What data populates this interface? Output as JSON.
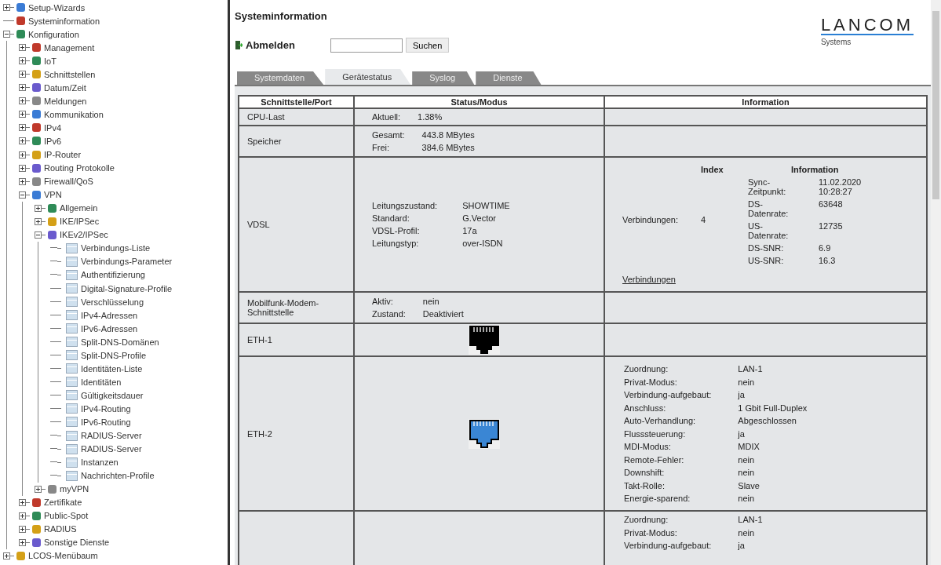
{
  "tree": [
    {
      "label": "Setup-Wizards",
      "expanded": false
    },
    {
      "label": "Systeminformation"
    },
    {
      "label": "Konfiguration",
      "expanded": true,
      "children": [
        {
          "label": "Management",
          "expanded": false
        },
        {
          "label": "IoT",
          "expanded": false
        },
        {
          "label": "Schnittstellen",
          "expanded": false
        },
        {
          "label": "Datum/Zeit",
          "expanded": false
        },
        {
          "label": "Meldungen",
          "expanded": false
        },
        {
          "label": "Kommunikation",
          "expanded": false
        },
        {
          "label": "IPv4",
          "expanded": false
        },
        {
          "label": "IPv6",
          "expanded": false
        },
        {
          "label": "IP-Router",
          "expanded": false
        },
        {
          "label": "Routing Protokolle",
          "expanded": false
        },
        {
          "label": "Firewall/QoS",
          "expanded": false
        },
        {
          "label": "VPN",
          "expanded": true,
          "children": [
            {
              "label": "Allgemein",
              "expanded": false
            },
            {
              "label": "IKE/IPSec",
              "expanded": false
            },
            {
              "label": "IKEv2/IPSec",
              "expanded": true,
              "children": [
                {
                  "label": "Verbindungs-Liste"
                },
                {
                  "label": "Verbindungs-Parameter"
                },
                {
                  "label": "Authentifizierung"
                },
                {
                  "label": "Digital-Signature-Profile"
                },
                {
                  "label": "Verschlüsselung"
                },
                {
                  "label": "IPv4-Adressen"
                },
                {
                  "label": "IPv6-Adressen"
                },
                {
                  "label": "Split-DNS-Domänen"
                },
                {
                  "label": "Split-DNS-Profile"
                },
                {
                  "label": "Identitäten-Liste"
                },
                {
                  "label": "Identitäten"
                },
                {
                  "label": "Gültigkeitsdauer"
                },
                {
                  "label": "IPv4-Routing"
                },
                {
                  "label": "IPv6-Routing"
                },
                {
                  "label": "RADIUS-Server"
                },
                {
                  "label": "RADIUS-Server"
                },
                {
                  "label": "Instanzen"
                },
                {
                  "label": "Nachrichten-Profile"
                }
              ]
            },
            {
              "label": "myVPN",
              "expanded": false
            }
          ]
        },
        {
          "label": "Zertifikate",
          "expanded": false
        },
        {
          "label": "Public-Spot",
          "expanded": false
        },
        {
          "label": "RADIUS",
          "expanded": false
        },
        {
          "label": "Sonstige Dienste",
          "expanded": false
        }
      ]
    },
    {
      "label": "LCOS-Menübaum",
      "expanded": false
    }
  ],
  "page_title": "Systeminformation",
  "logout": "Abmelden",
  "search_button": "Suchen",
  "logo": {
    "name": "LANCOM",
    "tagline": "Systems"
  },
  "tabs": [
    {
      "label": "Systemdaten",
      "selected": false
    },
    {
      "label": "Gerätestatus",
      "selected": true
    },
    {
      "label": "Syslog",
      "selected": false
    },
    {
      "label": "Dienste",
      "selected": false
    }
  ],
  "columns": [
    "Schnittstelle/Port",
    "Status/Modus",
    "Information"
  ],
  "rows": [
    {
      "name": "CPU-Last",
      "status": {
        "kind": "pairs",
        "pairs": [
          [
            "Aktuell:",
            "1.38%"
          ]
        ]
      }
    },
    {
      "name": "Speicher",
      "status": {
        "kind": "pairs",
        "pairs": [
          [
            "Gesamt:",
            "443.8 MBytes"
          ],
          [
            "Frei:",
            "384.6 MBytes"
          ]
        ]
      }
    },
    {
      "name": "VDSL",
      "status": {
        "kind": "pairs",
        "pairs": [
          [
            "Leitungszustand:",
            "SHOWTIME"
          ],
          [
            "Standard:",
            "G.Vector"
          ],
          [
            "VDSL-Profil:",
            "17a"
          ],
          [
            "Leitungstyp:",
            "over-ISDN"
          ]
        ]
      },
      "info": {
        "kind": "connections",
        "index_header": "Index",
        "info_header": "Information",
        "label": "Verbindungen:",
        "index": "4",
        "pairs": [
          [
            "Sync-Zeitpunkt:",
            "11.02.2020 10:28:27"
          ],
          [
            "DS-Datenrate:",
            "63648"
          ],
          [
            "US-Datenrate:",
            "12735"
          ],
          [
            "DS-SNR:",
            "6.9"
          ],
          [
            "US-SNR:",
            "16.3"
          ]
        ],
        "link": "Verbindungen"
      }
    },
    {
      "name": "Mobilfunk-Modem-Schnittstelle",
      "status": {
        "kind": "pairs",
        "pairs": [
          [
            "Aktiv:",
            "nein"
          ],
          [
            "Zustand:",
            "Deaktiviert"
          ]
        ]
      }
    },
    {
      "name": "ETH-1",
      "status": {
        "kind": "port",
        "link_up": false
      }
    },
    {
      "name": "ETH-2",
      "status": {
        "kind": "port",
        "link_up": true
      },
      "info": {
        "kind": "pairs",
        "pairs": [
          [
            "Zuordnung:",
            "LAN-1"
          ],
          [
            "Privat-Modus:",
            "nein"
          ],
          [
            "Verbindung-aufgebaut:",
            "ja"
          ],
          [
            "Anschluss:",
            "1 Gbit Full-Duplex"
          ],
          [
            "Auto-Verhandlung:",
            "Abgeschlossen"
          ],
          [
            "Flusssteuerung:",
            "ja"
          ],
          [
            "MDI-Modus:",
            "MDIX"
          ],
          [
            "Remote-Fehler:",
            "nein"
          ],
          [
            "Downshift:",
            "nein"
          ],
          [
            "Takt-Rolle:",
            "Slave"
          ],
          [
            "Energie-sparend:",
            "nein"
          ]
        ]
      }
    },
    {
      "info": {
        "kind": "pairs",
        "pairs": [
          [
            "Zuordnung:",
            "LAN-1"
          ],
          [
            "Privat-Modus:",
            "nein"
          ],
          [
            "Verbindung-aufgebaut:",
            "ja"
          ]
        ]
      }
    }
  ]
}
